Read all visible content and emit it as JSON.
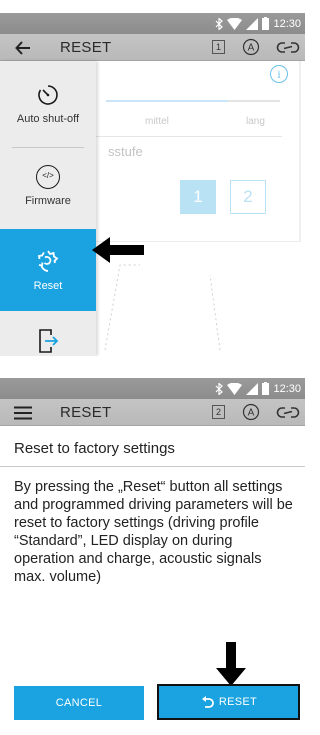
{
  "status_bar": {
    "time": "12:30",
    "icons": [
      "bluetooth-icon",
      "wifi-icon",
      "signal-icon",
      "battery-icon"
    ]
  },
  "screen1": {
    "appbar": {
      "title": "RESET",
      "lead_icon": "back-arrow-icon",
      "device_number": "1",
      "badge_letter": "A",
      "link_icon": "link-icon"
    },
    "background": {
      "info_glyph": "i",
      "label_mittel": "mittel",
      "label_lang": "lang",
      "label_stufe": "sstufe",
      "step_buttons": [
        "1",
        "2"
      ],
      "slider_level": 0.65
    },
    "menu": {
      "items": [
        {
          "label": "Auto shut-off",
          "icon": "timer-icon"
        },
        {
          "label": "Firmware",
          "icon": "firmware-icon",
          "icon_text": "</>"
        },
        {
          "label": "Reset",
          "icon": "reset-gear-icon",
          "selected": true
        },
        {
          "label": "",
          "icon": "export-icon"
        }
      ]
    },
    "pointer": "left-arrow-pointer"
  },
  "screen2": {
    "appbar": {
      "title": "RESET",
      "lead_icon": "hamburger-menu-icon",
      "device_number": "2",
      "badge_letter": "A",
      "link_icon": "link-icon"
    },
    "dialog": {
      "title": "Reset to factory settings",
      "body": "By pressing the „Reset“ button all settings and programmed driving parameters will be reset to factory settings (driving profile “Standard”, LED display on during operation and charge, acoustic signals max. volume)",
      "cancel_label": "CANCEL",
      "reset_label": "RESET"
    },
    "pointer": "down-arrow-pointer"
  },
  "colors": {
    "accent": "#1aa3e0",
    "statusbar": "#929292",
    "appbar": "#bfbfbf",
    "menu_bg": "#ececec"
  }
}
